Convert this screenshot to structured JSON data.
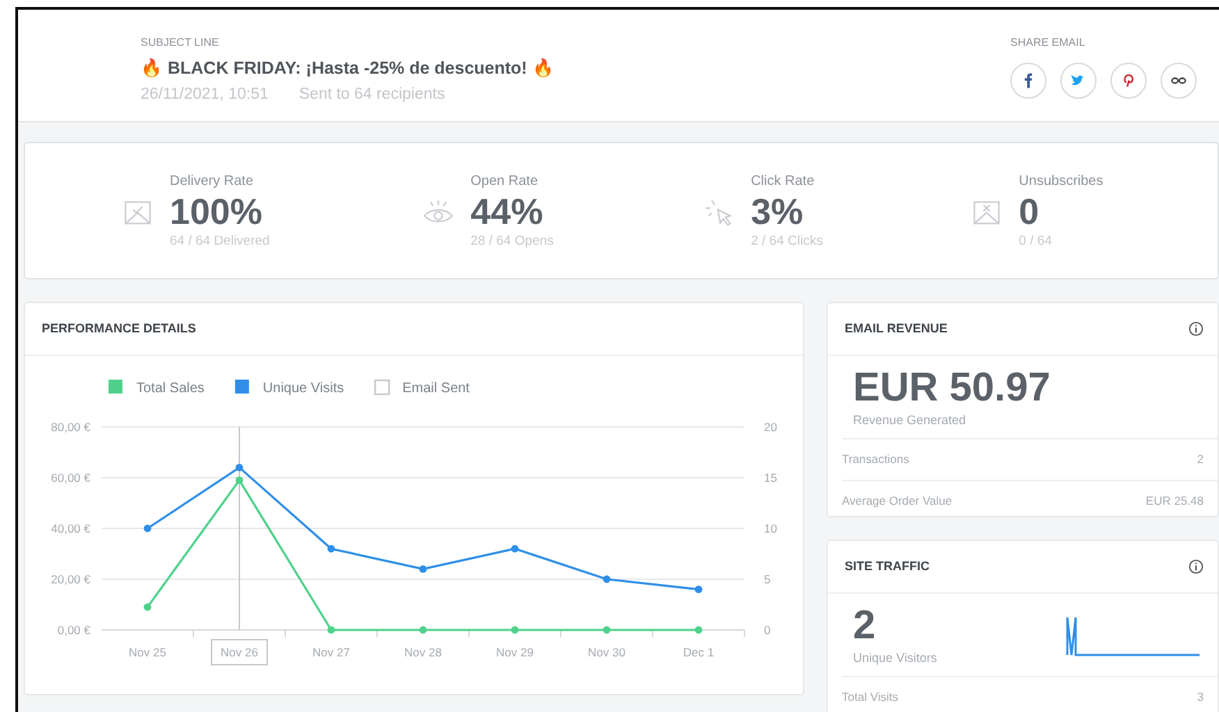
{
  "header": {
    "subject_label": "SUBJECT LINE",
    "subject": "🔥 BLACK FRIDAY: ¡Hasta -25% de descuento! 🔥",
    "date": "26/11/2021, 10:51",
    "recipients": "Sent to 64 recipients",
    "share_label": "SHARE EMAIL",
    "share_buttons": [
      {
        "kind": "facebook"
      },
      {
        "kind": "twitter"
      },
      {
        "kind": "pinterest"
      },
      {
        "kind": "link"
      }
    ]
  },
  "stats": [
    {
      "kind": "delivery",
      "label": "Delivery Rate",
      "value": "100%",
      "detail": "64 / 64 Delivered"
    },
    {
      "kind": "open",
      "label": "Open Rate",
      "value": "44%",
      "detail": "28 / 64 Opens"
    },
    {
      "kind": "click",
      "label": "Click Rate",
      "value": "3%",
      "detail": "2 / 64 Clicks"
    },
    {
      "kind": "unsubscribe",
      "label": "Unsubscribes",
      "value": "0",
      "detail": "0 / 64"
    }
  ],
  "performance": {
    "title": "PERFORMANCE DETAILS",
    "chart_data": {
      "type": "line",
      "categories": [
        "Nov 25",
        "Nov 26",
        "Nov 27",
        "Nov 28",
        "Nov 29",
        "Nov 30",
        "Dec 1"
      ],
      "series": [
        {
          "name": "Total Sales",
          "color": "#4fd18b",
          "marker": "circle",
          "values": [
            9,
            59,
            0,
            0,
            0,
            0,
            0
          ]
        },
        {
          "name": "Unique Visits",
          "color": "#2f8fe8",
          "axis": "y2",
          "marker": "circle",
          "values": [
            10,
            16,
            8,
            6,
            8,
            5,
            4
          ]
        }
      ],
      "grid": true,
      "legend": "top",
      "ylim": [
        0,
        80
      ],
      "yticks": [
        {
          "value": 0,
          "label": "0,00 €"
        },
        {
          "value": 20,
          "label": "20,00 €"
        },
        {
          "value": 40,
          "label": "40,00 €"
        },
        {
          "value": 60,
          "label": "60,00 €"
        },
        {
          "value": 80,
          "label": "80,00 €"
        }
      ],
      "y2lim": [
        0,
        20
      ],
      "y2ticks": [
        0,
        5,
        10,
        15,
        20
      ],
      "ref_lines": [
        {
          "axis": "x",
          "value": "Nov 26",
          "label": "Email Sent"
        }
      ]
    }
  },
  "revenue": {
    "title": "EMAIL REVENUE",
    "value": "EUR 50.97",
    "caption": "Revenue Generated",
    "rows": [
      {
        "label": "Transactions",
        "value": "2"
      },
      {
        "label": "Average Order Value",
        "value": "EUR 25.48"
      }
    ]
  },
  "traffic": {
    "title": "SITE TRAFFIC",
    "value": "2",
    "caption": "Unique Visitors",
    "rows": [
      {
        "label": "Total Visits",
        "value": "3"
      }
    ]
  }
}
